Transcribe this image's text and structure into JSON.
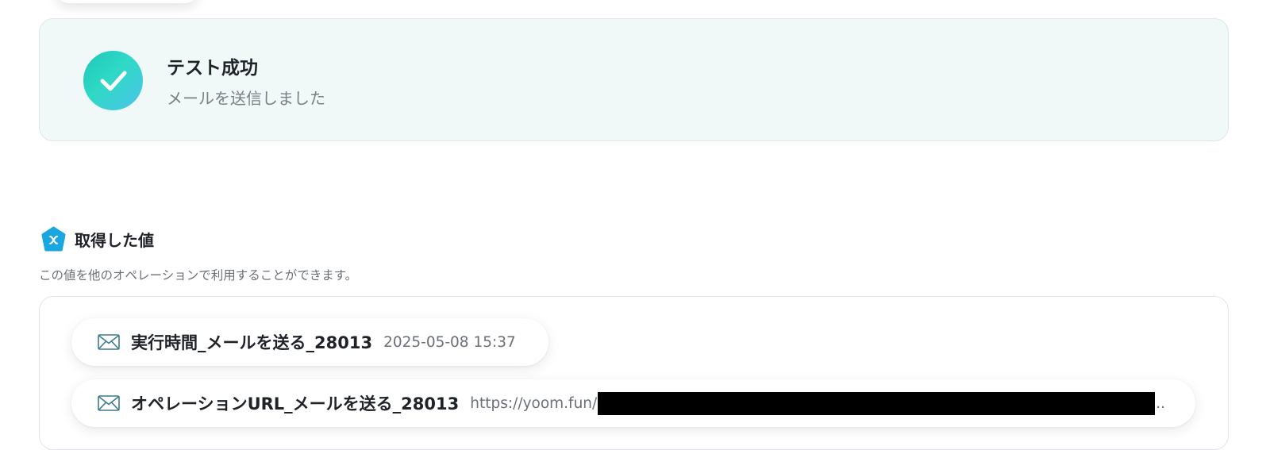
{
  "test_result": {
    "title": "テスト成功",
    "subtitle": "メールを送信しました",
    "icon": "check-icon"
  },
  "values_section": {
    "title": "取得した値",
    "description": "この値を他のオペレーションで利用することができます。",
    "icon": "variable-icon",
    "items": [
      {
        "label": "実行時間_メールを送る_28013",
        "value": "2025-05-08 15:37",
        "icon": "mail-icon"
      },
      {
        "label": "オペレーションURL_メールを送る_28013",
        "value": "https://yoom.fun/",
        "redacted": true,
        "suffix": "..",
        "icon": "mail-icon"
      }
    ]
  },
  "colors": {
    "success_bg": "#f1f9f8",
    "accent_teal": "#1ec7b8",
    "accent_blue": "#1aa6e0"
  }
}
